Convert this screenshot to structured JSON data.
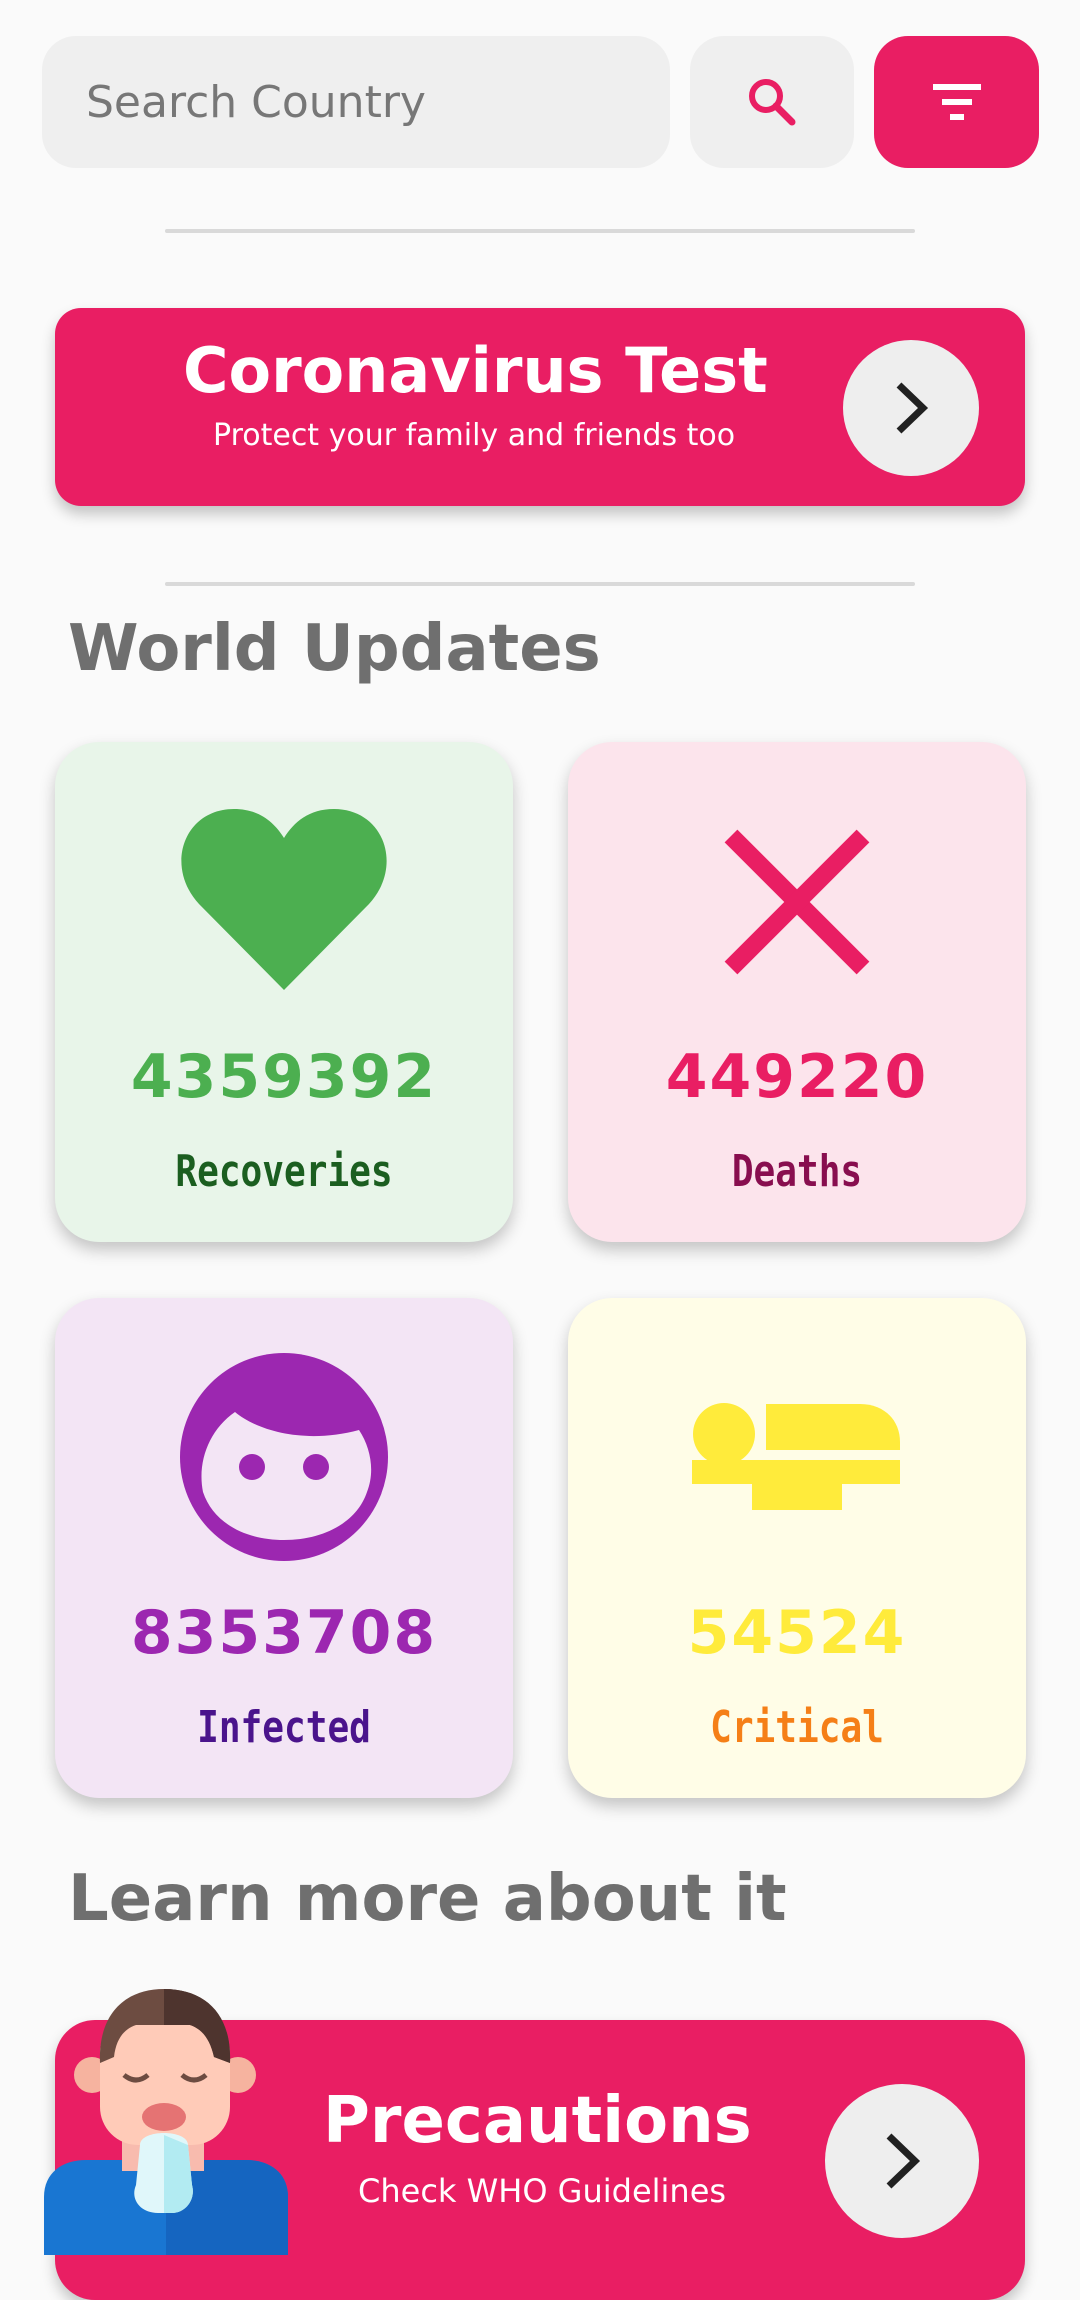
{
  "search": {
    "placeholder": "Search Country"
  },
  "test_banner": {
    "title": "Coronavirus Test",
    "subtitle": "Protect your family and friends too"
  },
  "world_updates": {
    "title": "World Updates",
    "cards": [
      {
        "value": "4359392",
        "label": "Recoveries",
        "icon": "heart-icon",
        "bg": "#e8f5e9",
        "value_color": "#4caf50",
        "label_color": "#1b5e20"
      },
      {
        "value": "449220",
        "label": "Deaths",
        "icon": "close-icon",
        "bg": "#fce4ec",
        "value_color": "#e91e63",
        "label_color": "#880e4f"
      },
      {
        "value": "8353708",
        "label": "Infected",
        "icon": "face-icon",
        "bg": "#f3e5f5",
        "value_color": "#9c27b0",
        "label_color": "#4a148c"
      },
      {
        "value": "54524",
        "label": "Critical",
        "icon": "hospital-bed-icon",
        "bg": "#fffde7",
        "value_color": "#ffeb3b",
        "label_color": "#f57f17"
      }
    ]
  },
  "learn_more": {
    "title": "Learn more about it",
    "precautions": {
      "title": "Precautions",
      "subtitle": "Check WHO Guidelines"
    }
  },
  "colors": {
    "accent": "#e91e63",
    "background": "#fafafa"
  }
}
